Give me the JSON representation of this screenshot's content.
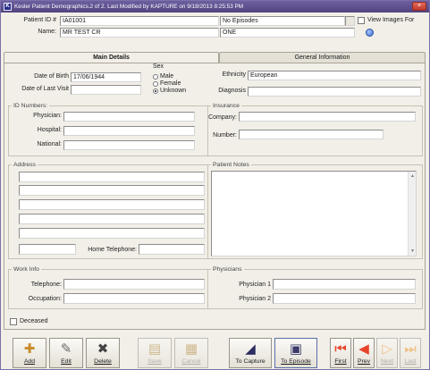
{
  "window": {
    "title": "Kesler Patient Demographics.2 of 2. Last Modified by KAPTURE on 9/18/2013 8:25:53 PM",
    "app_icon": "K",
    "close_symbol": "×"
  },
  "header": {
    "patient_id_label": "Patient ID #",
    "patient_id_value": "IA01001",
    "episodes_value": "No Episodes",
    "name_label": "Name:",
    "name_value": "MR TEST CR",
    "name_extra_value": "ONE",
    "view_images_label": "View Images For"
  },
  "tabs": [
    {
      "label": "Main Details",
      "active": true
    },
    {
      "label": "General Information",
      "active": false
    }
  ],
  "main": {
    "dob_label": "Date of Birth",
    "dob_value": "17/06/1944",
    "last_visit_label": "Date of Last Visit",
    "last_visit_value": "",
    "sex": {
      "label": "Sex",
      "options": [
        "Male",
        "Female",
        "Unknown"
      ],
      "selected": "Unknown"
    },
    "ethnicity_label": "Ethnicity",
    "ethnicity_value": "European",
    "diagnosis_label": "Diagnosis",
    "diagnosis_value": "",
    "id_numbers": {
      "title": "ID Numbers:",
      "physician_label": "Physician:",
      "hospital_label": "Hospital:",
      "national_label": "National:"
    },
    "insurance": {
      "title": "Insurance",
      "company_label": "Company:",
      "number_label": "Number:"
    },
    "address": {
      "title": "Address",
      "home_telephone_label": "Home Telephone:"
    },
    "patient_notes_title": "Patient Notes",
    "work_info": {
      "title": "Work Info",
      "telephone_label": "Telephone:",
      "occupation_label": "Occupation:"
    },
    "physicians": {
      "title": "Physicians",
      "physician1_label": "Physician 1",
      "physician2_label": "Physician 2"
    },
    "deceased_label": "Deceased"
  },
  "toolbar": {
    "add": "Add",
    "edit": "Edit",
    "delete": "Delete",
    "save": "Save",
    "cancel": "Cancel",
    "to_capture": "To Capture",
    "to_episode": "To Episode",
    "first": "First",
    "prev": "Prev",
    "next": "Next",
    "last": "Last"
  },
  "colors": {
    "titlebar": "#5f5191",
    "window_bg": "#f2efe8",
    "nav_red": "#e8432b",
    "nav_orange": "#f0a040"
  }
}
